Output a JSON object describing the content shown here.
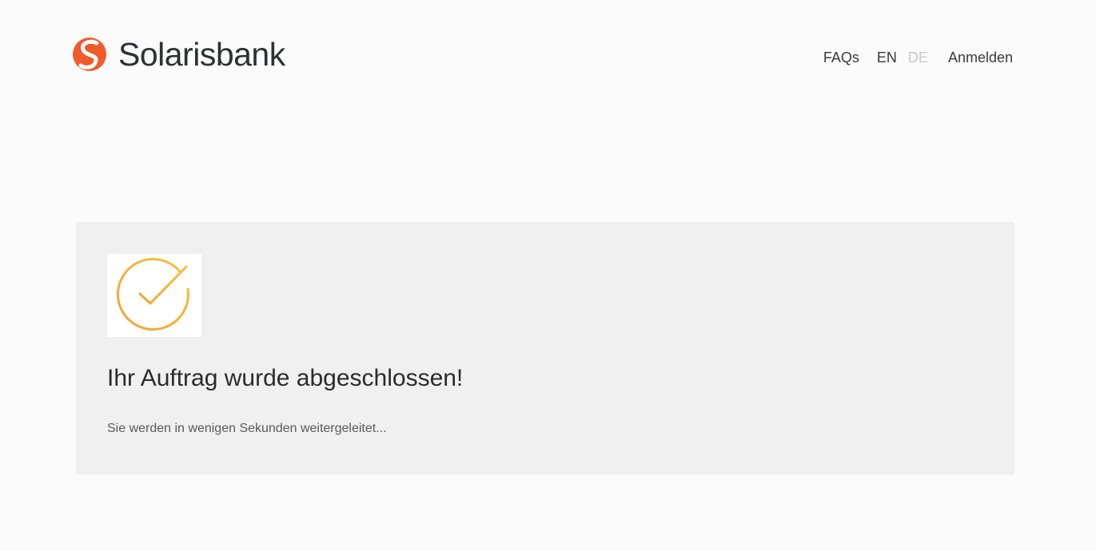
{
  "header": {
    "brand": "Solarisbank",
    "logo_icon": "solarisbank-logo-icon",
    "nav": {
      "faqs_label": "FAQs",
      "lang_en_label": "EN",
      "lang_de_label": "DE",
      "login_label": "Anmelden"
    }
  },
  "status_card": {
    "icon": "check-circle-icon",
    "title": "Ihr Auftrag wurde abgeschlossen!",
    "message": "Sie werden in wenigen Sekunden weitergeleitet..."
  },
  "colors": {
    "brand_orange": "#f15a29",
    "check_gradient_start": "#f4a13a",
    "check_gradient_end": "#f5c23b",
    "card_background": "#f0f0f0"
  }
}
